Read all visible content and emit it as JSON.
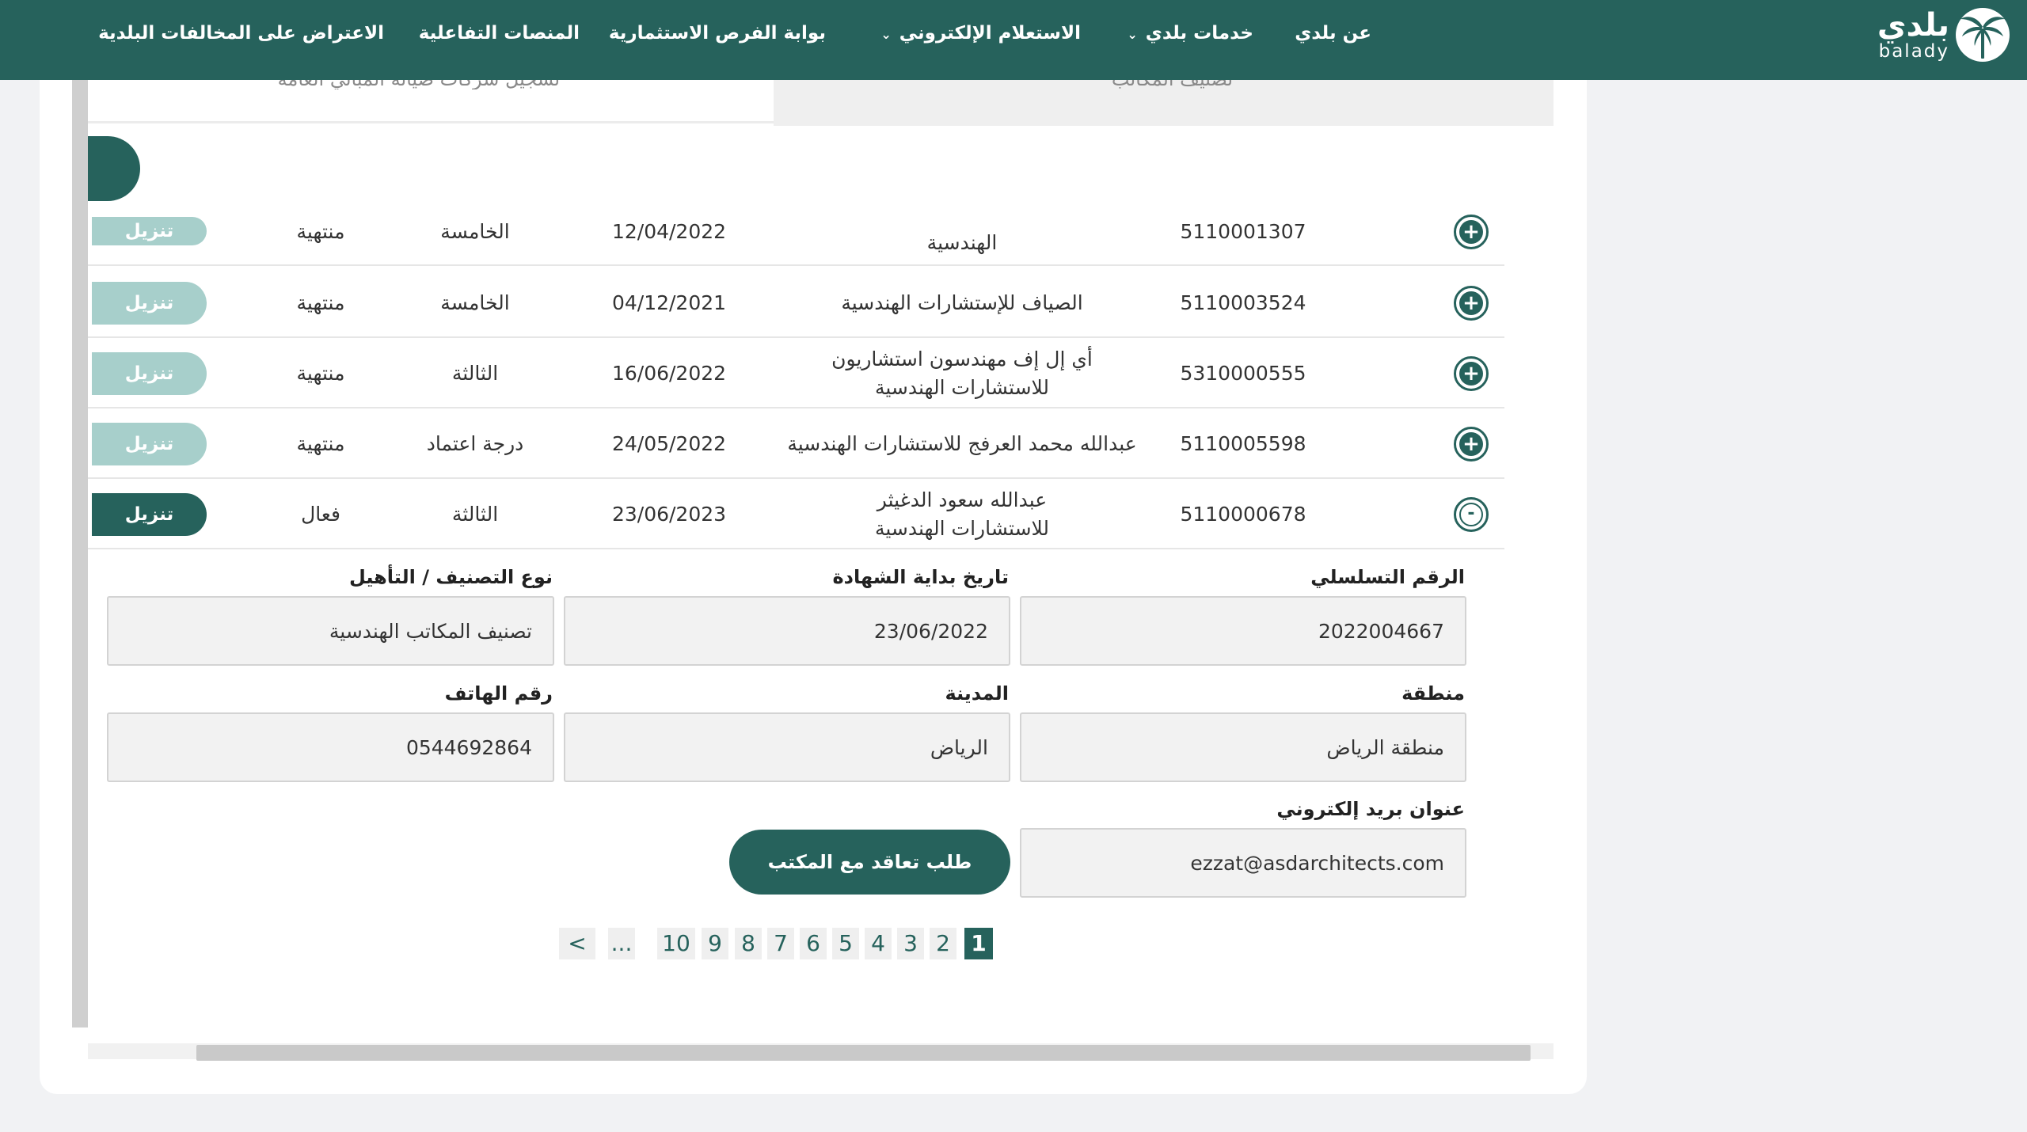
{
  "brand": {
    "arabic": "بلدي",
    "latin": "balady"
  },
  "nav": {
    "about": "عن بلدي",
    "services": "خدمات بلدي",
    "inquiry": "الاستعلام الإلكتروني",
    "investment": "بوابة الفرص الاستثمارية",
    "platforms": "المنصات التفاعلية",
    "objection": "الاعتراض على المخالفات البلدية"
  },
  "tabs": {
    "right": "تصنيف المكاتب",
    "left": "تسجيل شركات صيانة المباني العامة"
  },
  "rows": [
    {
      "reg": "5110001307",
      "name": "الهندسية",
      "date": "12/04/2022",
      "class": "الخامسة",
      "status": "منتهية",
      "download": "تنزيل",
      "toggle": "+"
    },
    {
      "reg": "5110003524",
      "name": "الصياف للإستشارات الهندسية",
      "date": "04/12/2021",
      "class": "الخامسة",
      "status": "منتهية",
      "download": "تنزيل",
      "toggle": "+"
    },
    {
      "reg": "5310000555",
      "name": "أي إل إف مهندسون استشاريون للاستشارات الهندسية",
      "date": "16/06/2022",
      "class": "الثالثة",
      "status": "منتهية",
      "download": "تنزيل",
      "toggle": "+"
    },
    {
      "reg": "5110005598",
      "name": "عبدالله محمد العرفج للاستشارات الهندسية",
      "date": "24/05/2022",
      "class": "درجة اعتماد",
      "status": "منتهية",
      "download": "تنزيل",
      "toggle": "+"
    },
    {
      "reg": "5110000678",
      "name": "عبدالله سعود الدغيثر للاستشارات الهندسية",
      "date": "23/06/2023",
      "class": "الثالثة",
      "status": "فعال",
      "download": "تنزيل",
      "toggle": "-"
    }
  ],
  "details": {
    "serial_label": "الرقم التسلسلي",
    "serial_value": "2022004667",
    "cert_start_label": "تاريخ بداية الشهادة",
    "cert_start_value": "23/06/2022",
    "class_type_label": "نوع التصنيف / التأهيل",
    "class_type_value": "تصنيف المكاتب الهندسية",
    "region_label": "منطقة",
    "region_value": "منطقة الرياض",
    "city_label": "المدينة",
    "city_value": "الرياض",
    "phone_label": "رقم الهاتف",
    "phone_value": "0544692864",
    "email_label": "عنوان بريد إلكتروني",
    "email_value": "ezzat@asdarchitects.com",
    "contract_button": "طلب تعاقد مع المكتب"
  },
  "pagination": {
    "pages": [
      "1",
      "2",
      "3",
      "4",
      "5",
      "6",
      "7",
      "8",
      "9",
      "10"
    ],
    "current": "1",
    "ellipsis": "...",
    "next": ">"
  },
  "colors": {
    "primary": "#26625c",
    "download_inactive": "#a7cfcb",
    "field_bg": "#f2f2f2"
  }
}
